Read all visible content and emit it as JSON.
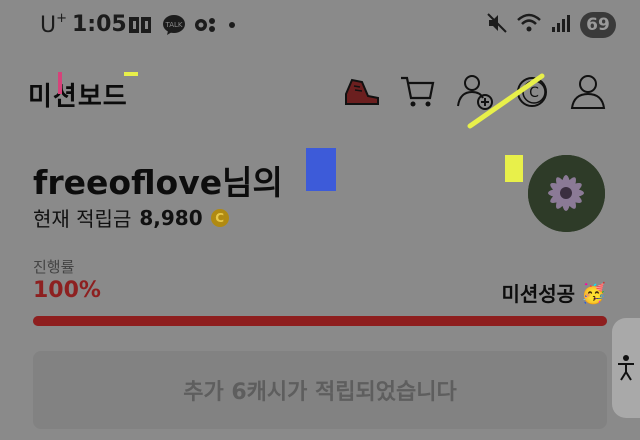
{
  "status_bar": {
    "carrier": "U",
    "carrier_sup": "+",
    "time": "1:05",
    "battery": "69",
    "icons": [
      "cloud-app-icon",
      "talk-icon",
      "notification-app-icon",
      "dot-icon",
      "mute-icon",
      "wifi-icon",
      "signal-icon"
    ]
  },
  "header": {
    "title": "미션보드",
    "icons": [
      "sneaker-icon",
      "cart-icon",
      "add-friend-icon",
      "coin-icon",
      "profile-icon"
    ]
  },
  "profile": {
    "username": "freeoflove님의",
    "points_label": "현재 적립금",
    "points_value": "8,980",
    "coin_symbol": "C"
  },
  "progress": {
    "label": "진행률",
    "value_text": "100%",
    "fraction": 1.0,
    "status": "미션성공",
    "status_emoji": "🥳"
  },
  "notice": {
    "text": "추가 6캐시가 적립되었습니다"
  },
  "colors": {
    "accent_red": "#8e1e1e",
    "overlay_gray": "#8a8a8a",
    "coin_gold": "#b08a12"
  }
}
